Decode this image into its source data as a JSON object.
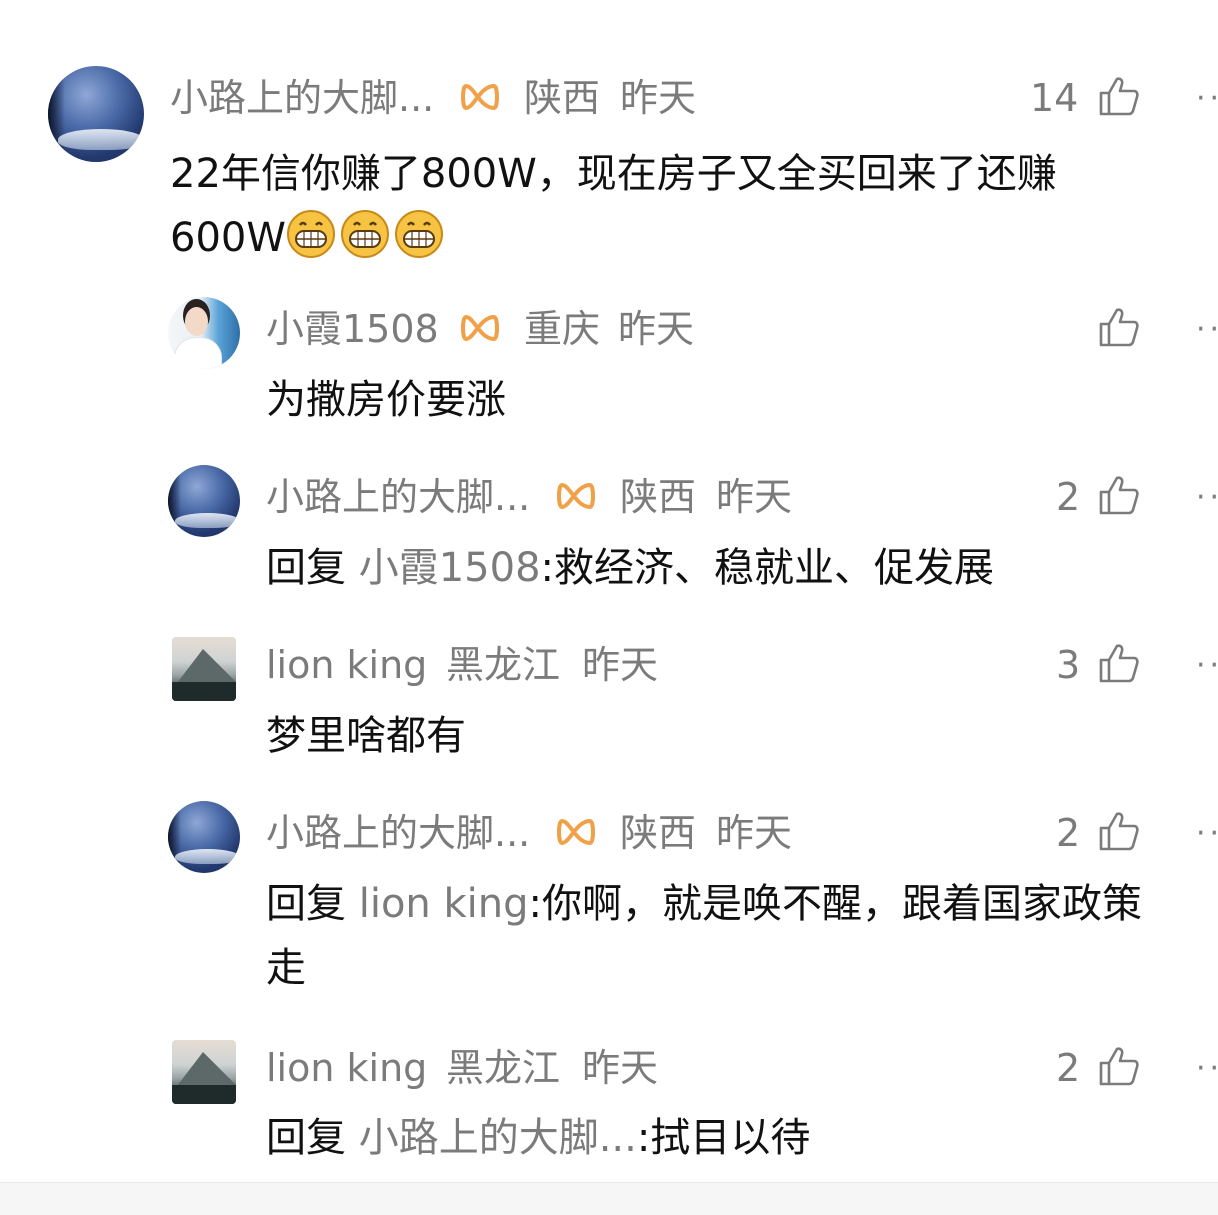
{
  "comments": [
    {
      "name": "小路上的大脚...",
      "location": "陕西",
      "time": "昨天",
      "likes": "14",
      "text_main": "22年信你赚了800W，现在房子又全买回来了还赚",
      "text_line2": "600W",
      "emoji_count": 3
    },
    {
      "name": "小霞1508",
      "location": "重庆",
      "time": "昨天",
      "likes": "",
      "text": "为撒房价要涨"
    },
    {
      "name": "小路上的大脚...",
      "location": "陕西",
      "time": "昨天",
      "likes": "2",
      "reply_prefix": "回复",
      "reply_target": "小霞1508",
      "reply_text": ":救经济、稳就业、促发展"
    },
    {
      "name": "lion king",
      "location": "黑龙江",
      "time": "昨天",
      "likes": "3",
      "text": "梦里啥都有"
    },
    {
      "name": "小路上的大脚...",
      "location": "陕西",
      "time": "昨天",
      "likes": "2",
      "reply_prefix": "回复",
      "reply_target": "lion king",
      "reply_text": ":你啊，就是唤不醒，跟着国家政策",
      "reply_text_line2": "走"
    },
    {
      "name": "lion king",
      "location": "黑龙江",
      "time": "昨天",
      "likes": "2",
      "reply_prefix": "回复",
      "reply_target": "小路上的大脚...",
      "reply_text": ":拭目以待"
    }
  ],
  "icons": {
    "vip": "vip-badge-icon",
    "like": "thumbs-up-icon",
    "more": "more-dots-icon",
    "emoji": "grinning-emoji-icon"
  },
  "colors": {
    "meta_gray": "#7b7b7b",
    "text_black": "#111111",
    "vip_orange": "#f0a14a",
    "emoji_yellow": "#f6c343"
  },
  "more_glyph": "··"
}
